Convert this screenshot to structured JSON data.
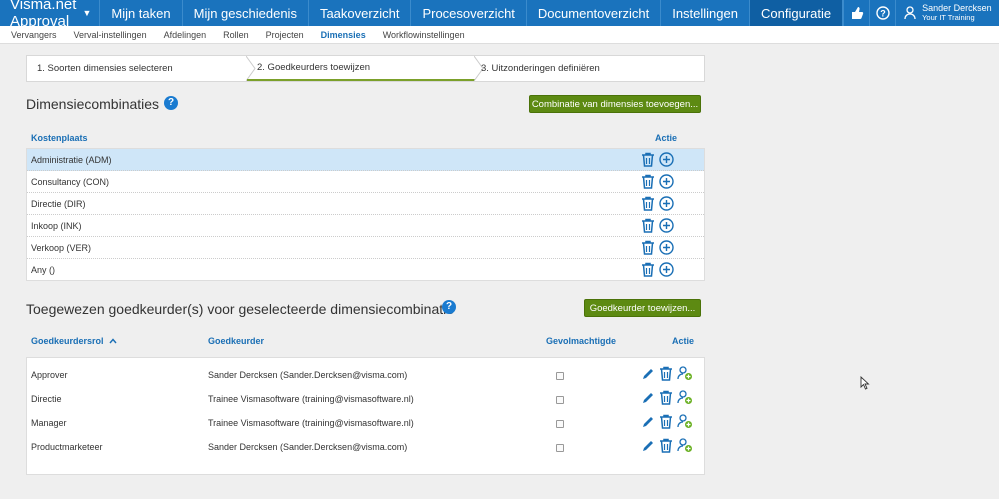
{
  "app": {
    "title": "Visma.net Approval"
  },
  "nav": {
    "items": [
      "Mijn taken",
      "Mijn geschiedenis",
      "Taakoverzicht",
      "Procesoverzicht",
      "Documentoverzicht",
      "Instellingen",
      "Configuratie"
    ],
    "active": "Configuratie"
  },
  "user": {
    "name": "Sander Dercksen",
    "org": "Your IT Training"
  },
  "subnav": {
    "items": [
      "Vervangers",
      "Verval-instellingen",
      "Afdelingen",
      "Rollen",
      "Projecten",
      "Dimensies",
      "Workflowinstellingen"
    ],
    "active": "Dimensies"
  },
  "wizard": {
    "steps": [
      "1. Soorten dimensies selecteren",
      "2. Goedkeurders toewijzen",
      "3. Uitzonderingen definiëren"
    ],
    "active_index": 1
  },
  "dimensions": {
    "title": "Dimensiecombinaties",
    "add_button": "Combinatie van dimensies toevoegen...",
    "col_kostenplaats": "Kostenplaats",
    "col_actie": "Actie",
    "rows": [
      "Administratie (ADM)",
      "Consultancy (CON)",
      "Directie (DIR)",
      "Inkoop (INK)",
      "Verkoop (VER)",
      "Any ()"
    ],
    "selected_index": 0
  },
  "approvers": {
    "title": "Toegewezen goedkeurder(s) voor geselecteerde dimensiecombinatie",
    "assign_button": "Goedkeurder toewijzen...",
    "col_role": "Goedkeurdersrol",
    "col_approver": "Goedkeurder",
    "col_proxy": "Gevolmachtigde",
    "col_actie": "Actie",
    "rows": [
      {
        "role": "Approver",
        "approver": "Sander Dercksen (Sander.Dercksen@visma.com)"
      },
      {
        "role": "Directie",
        "approver": "Trainee Vismasoftware (training@vismasoftware.nl)"
      },
      {
        "role": "Manager",
        "approver": "Trainee Vismasoftware (training@vismasoftware.nl)"
      },
      {
        "role": "Productmarketeer",
        "approver": "Sander Dercksen (Sander.Dercksen@visma.com)"
      }
    ]
  },
  "colors": {
    "topbar": "#1a73bd",
    "accent_green": "#5d8a12",
    "link_blue": "#1a6fb5",
    "selected_row": "#cfe6f8"
  }
}
